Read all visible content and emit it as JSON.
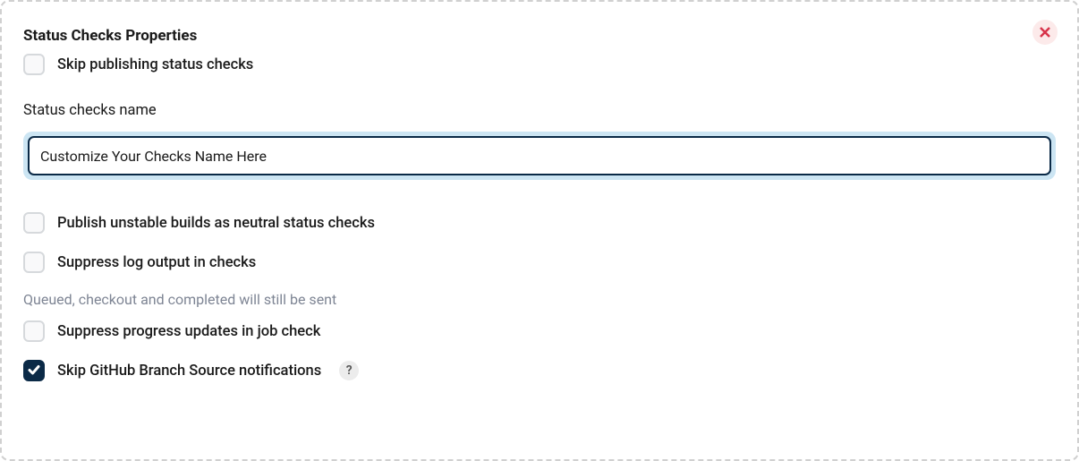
{
  "panel": {
    "title": "Status Checks Properties"
  },
  "checkboxes": {
    "skip_publish": {
      "label": "Skip publishing status checks",
      "checked": false
    },
    "publish_unstable": {
      "label": "Publish unstable builds as neutral status checks",
      "checked": false
    },
    "suppress_log": {
      "label": "Suppress log output in checks",
      "checked": false
    },
    "suppress_progress": {
      "label": "Suppress progress updates in job check",
      "checked": false
    },
    "skip_github_notifications": {
      "label": "Skip GitHub Branch Source notifications",
      "checked": true
    }
  },
  "field": {
    "status_checks_name": {
      "label": "Status checks name",
      "value": "Customize Your Checks Name Here"
    }
  },
  "hints": {
    "suppress_progress": "Queued, checkout and completed will still be sent"
  },
  "help": {
    "badge": "?"
  }
}
